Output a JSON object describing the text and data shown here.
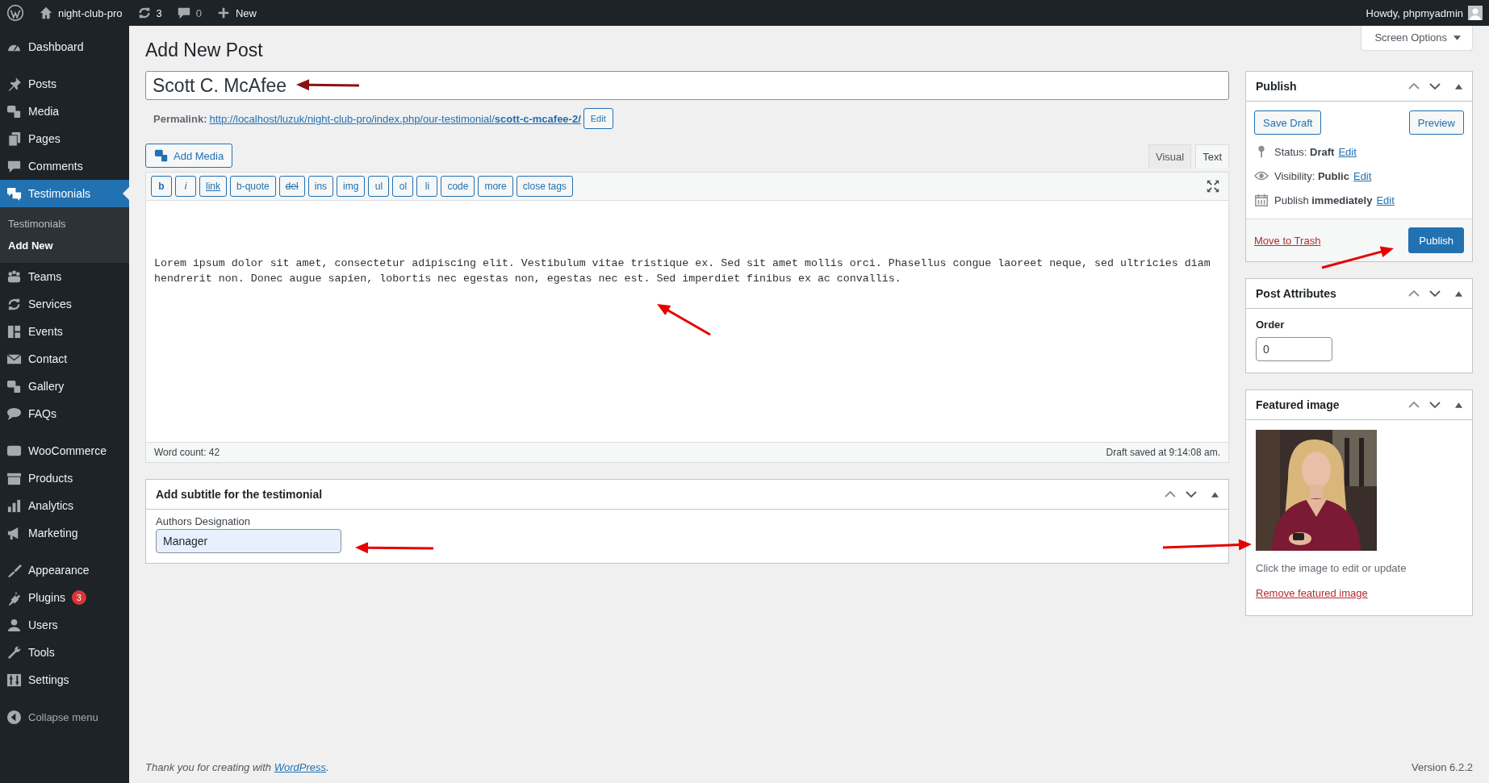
{
  "admin_bar": {
    "site": "night-club-pro",
    "updates": "3",
    "comments": "0",
    "new": "New",
    "greeting": "Howdy, phpmyadmin"
  },
  "menu_groups": [
    [
      {
        "label": "Dashboard",
        "selected": false
      }
    ],
    [
      {
        "label": "Posts",
        "selected": false
      },
      {
        "label": "Media",
        "selected": false
      },
      {
        "label": "Pages",
        "selected": false
      },
      {
        "label": "Comments",
        "selected": false
      },
      {
        "label": "Testimonials",
        "selected": true,
        "submenu": [
          {
            "label": "Testimonials",
            "selected": false
          },
          {
            "label": "Add New",
            "selected": true
          }
        ]
      },
      {
        "label": "Teams",
        "selected": false
      },
      {
        "label": "Services",
        "selected": false
      },
      {
        "label": "Events",
        "selected": false
      },
      {
        "label": "Contact",
        "selected": false
      },
      {
        "label": "Gallery",
        "selected": false
      },
      {
        "label": "FAQs",
        "selected": false
      }
    ],
    [
      {
        "label": "WooCommerce",
        "selected": false
      },
      {
        "label": "Products",
        "selected": false
      },
      {
        "label": "Analytics",
        "selected": false
      },
      {
        "label": "Marketing",
        "selected": false
      }
    ],
    [
      {
        "label": "Appearance",
        "selected": false
      },
      {
        "label": "Plugins",
        "selected": false,
        "badge": "3"
      },
      {
        "label": "Users",
        "selected": false
      },
      {
        "label": "Tools",
        "selected": false
      },
      {
        "label": "Settings",
        "selected": false
      }
    ]
  ],
  "collapse_menu": "Collapse menu",
  "page_title": "Add New Post",
  "screen_options": "Screen Options",
  "post_title": "Scott C. McAfee",
  "permalink": {
    "label": "Permalink:",
    "url": "http://localhost/luzuk/night-club-pro/index.php/our-testimonial/**scott-c-mcafee-2/**",
    "edit": "Edit"
  },
  "add_media": "Add Media",
  "editor_tabs": [
    {
      "label": "Visual",
      "selected": false
    },
    {
      "label": "Text",
      "selected": true
    }
  ],
  "quicktags": [
    {
      "label": "b",
      "kind": "bold"
    },
    {
      "label": "i",
      "kind": "italic"
    },
    {
      "label": "link",
      "kind": "underline"
    },
    {
      "label": "b-quote",
      "kind": "plain"
    },
    {
      "label": "del",
      "kind": "strike"
    },
    {
      "label": "ins",
      "kind": "plain"
    },
    {
      "label": "img",
      "kind": "plain"
    },
    {
      "label": "ul",
      "kind": "plain"
    },
    {
      "label": "ol",
      "kind": "plain"
    },
    {
      "label": "li",
      "kind": "plain"
    },
    {
      "label": "code",
      "kind": "plain"
    },
    {
      "label": "more",
      "kind": "plain"
    },
    {
      "label": "close tags",
      "kind": "plain"
    }
  ],
  "content": "Lorem ipsum dolor sit amet, consectetur adipiscing elit. Vestibulum vitae tristique ex. Sed sit amet mollis orci. Phasellus congue laoreet neque, sed ultricies diam hendrerit non. Donec augue sapien, lobortis nec egestas non, egestas nec est. Sed imperdiet finibus ex ac convallis.",
  "word_count": "Word count: 42",
  "draft_saved": "Draft saved at 9:14:08 am.",
  "subtitle_box": {
    "title": "Add subtitle for the testimonial",
    "label": "Authors Designation",
    "value": "Manager"
  },
  "publish_box": {
    "title": "Publish",
    "save_draft": "Save Draft",
    "preview": "Preview",
    "rows": [
      {
        "text": "Status: **Draft**",
        "link": "Edit"
      },
      {
        "text": "Visibility: **Public**",
        "link": "Edit"
      },
      {
        "text": "Publish **immediately**",
        "link": "Edit"
      }
    ],
    "trash": "Move to Trash",
    "publish": "Publish"
  },
  "attributes_box": {
    "title": "Post Attributes",
    "label": "Order",
    "value": "0"
  },
  "featured_box": {
    "title": "Featured image",
    "hint": "Click the image to edit or update",
    "remove": "Remove featured image"
  },
  "footer": {
    "text": "Thank you for creating with ",
    "link": "WordPress",
    "after": ".",
    "version": "Version 6.2.2"
  }
}
